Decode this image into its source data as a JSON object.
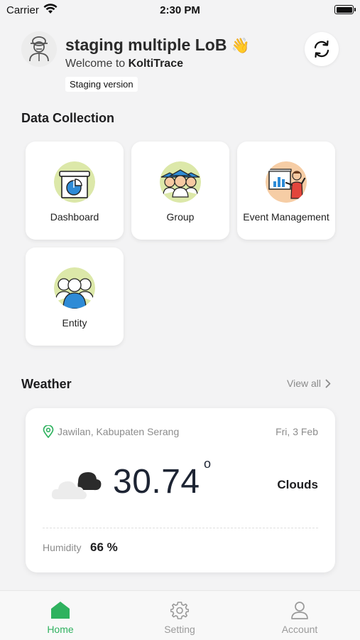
{
  "status_bar": {
    "carrier": "Carrier",
    "time": "2:30 PM"
  },
  "header": {
    "greeting": "staging multiple LoB",
    "greeting_emoji": "👋",
    "welcome_prefix": "Welcome to ",
    "app_name": "KoltiTrace",
    "version_badge": "Staging version"
  },
  "data_collection": {
    "title": "Data Collection",
    "tiles": [
      {
        "label": "Dashboard",
        "icon": "dashboard-icon"
      },
      {
        "label": "Group",
        "icon": "group-icon"
      },
      {
        "label": "Event Management",
        "icon": "event-management-icon"
      },
      {
        "label": "Entity",
        "icon": "entity-icon"
      }
    ]
  },
  "weather": {
    "title": "Weather",
    "view_all": "View all",
    "location": "Jawilan, Kabupaten Serang",
    "date": "Fri, 3 Feb",
    "temperature": "30.74",
    "degree_symbol": "o",
    "condition": "Clouds",
    "humidity_label": "Humidity",
    "humidity_value": "66 %"
  },
  "bottom_nav": {
    "items": [
      {
        "label": "Home",
        "icon": "home-icon",
        "active": true
      },
      {
        "label": "Setting",
        "icon": "gear-icon",
        "active": false
      },
      {
        "label": "Account",
        "icon": "user-icon",
        "active": false
      }
    ]
  },
  "colors": {
    "accent": "#2fb25f",
    "background": "#f3f3f4",
    "icon_bg_green": "#dce8a9",
    "dashboard_blue": "#2e8bd6"
  }
}
